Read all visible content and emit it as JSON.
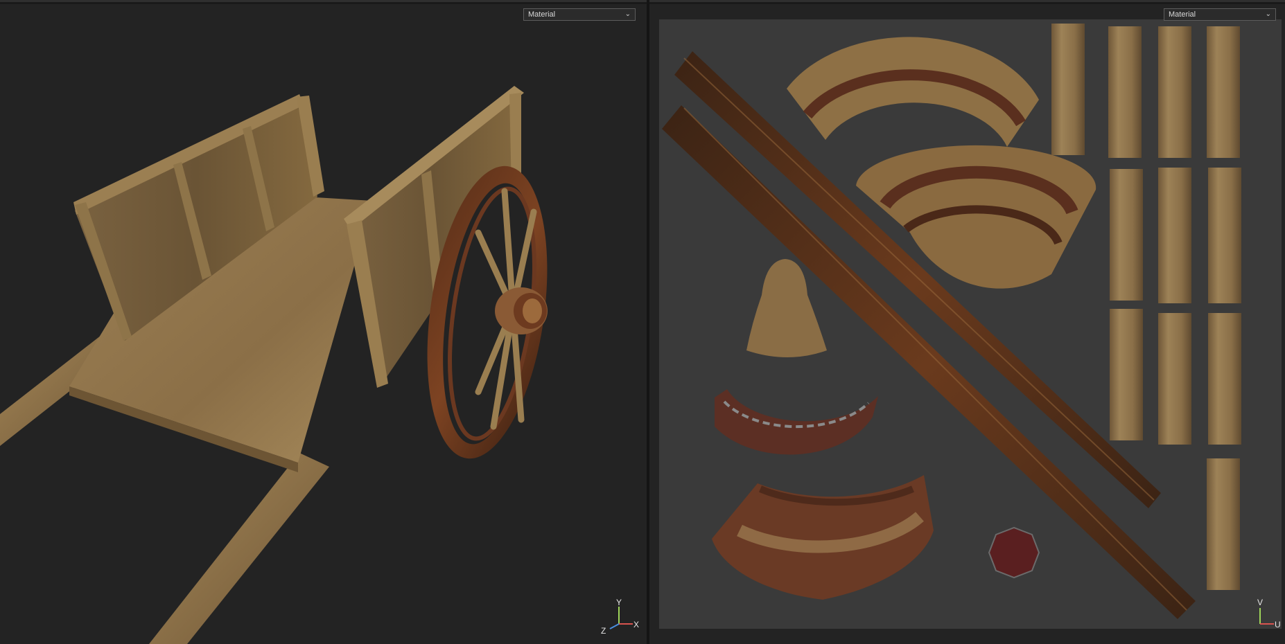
{
  "viewport_3d": {
    "shading_select": "Material",
    "axis_labels": {
      "x": "X",
      "y": "Y",
      "z": "Z"
    },
    "axis_colors": {
      "x": "#d9534f",
      "y": "#9fd55a",
      "z": "#4a8fe0"
    }
  },
  "viewport_uv": {
    "shading_select": "Material",
    "axis_labels": {
      "u": "U",
      "v": "V"
    },
    "canvas_color": "#3a3a3a"
  },
  "icons": [
    "chevron-down-icon",
    "axis-gizmo-icon"
  ],
  "colors": {
    "background": "#232323",
    "wood_light": "#a78b5c",
    "wood_dark": "#5b4227",
    "wheel_rim": "#6e3a1e",
    "rust_red": "#7a2d28"
  }
}
